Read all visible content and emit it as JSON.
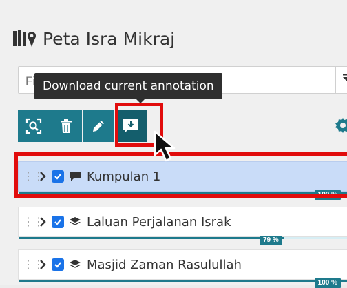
{
  "panel": {
    "title": "Peta Isra Mikraj"
  },
  "filter": {
    "placeholder": "Filter layers"
  },
  "tooltip": {
    "text": "Download current annotation"
  },
  "toolbar": {
    "buttons": [
      {
        "icon": "zoom-extent-icon",
        "label": "Zoom to layer"
      },
      {
        "icon": "trash-icon",
        "label": "Delete"
      },
      {
        "icon": "pencil-icon",
        "label": "Edit"
      },
      {
        "icon": "annotation-download-icon",
        "label": "Download current annotation"
      }
    ]
  },
  "layers": [
    {
      "name": "Kumpulan 1",
      "icon": "comment-icon",
      "checked": true,
      "selected": true,
      "progress_label": "100 %",
      "progress": 100
    },
    {
      "name": "Laluan Perjalanan Israk",
      "icon": "layers-icon",
      "checked": true,
      "selected": false,
      "progress_label": "79 %",
      "progress": 79
    },
    {
      "name": "Masjid Zaman Rasulullah",
      "icon": "layers-icon",
      "checked": true,
      "selected": false,
      "progress_label": "100 %",
      "progress": 100
    }
  ],
  "colors": {
    "accent": "#1e7a8c",
    "checkbox": "#1a73e8",
    "highlight": "#e10c0c",
    "selected_row": "#c9dcf8"
  }
}
